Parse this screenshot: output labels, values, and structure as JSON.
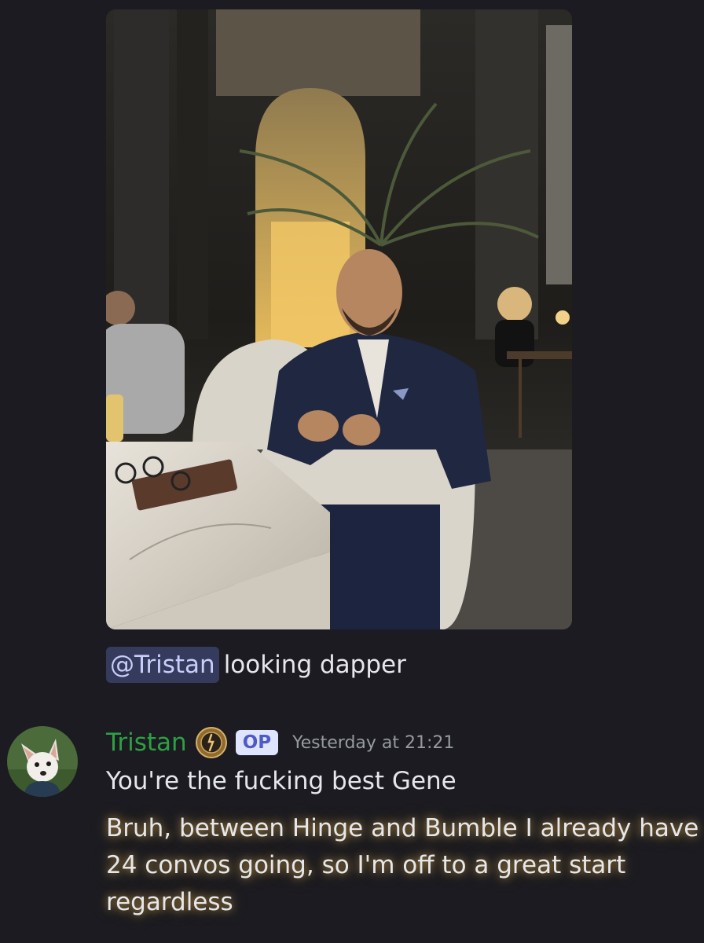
{
  "attachment": {
    "icon": "photo-man-in-navy-suit-lounge"
  },
  "message1": {
    "mention": "@Tristan",
    "text": "looking dapper"
  },
  "reply": {
    "avatar_icon": "dog-avatar-icon",
    "username": "Tristan",
    "role_icon": "badge-icon",
    "op_badge": "OP",
    "timestamp": "Yesterday at 21:21",
    "lines": [
      "You're the fucking best Gene",
      "Bruh, between Hinge and Bumble I already have",
      "24 convos going, so I'm off to a great start",
      "regardless"
    ]
  },
  "colors": {
    "background": "#1b1b21",
    "username": "#2ea043",
    "mention_bg": "#353b5c",
    "mention_fg": "#c9cdfb",
    "op_bg": "#dfe5ff",
    "op_fg": "#4f5bc4",
    "timestamp": "#979aa3"
  }
}
